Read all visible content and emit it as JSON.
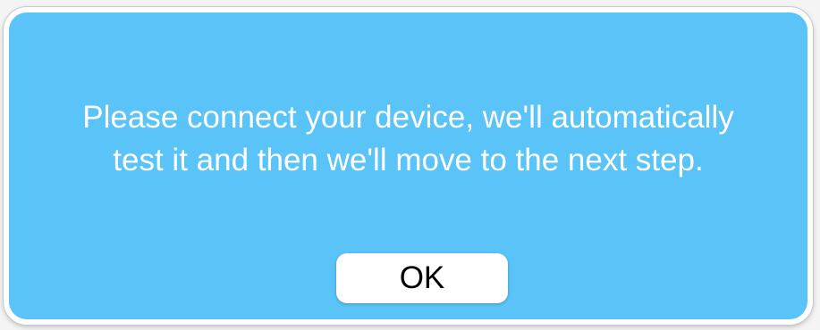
{
  "dialog": {
    "message_lines": [
      "Please connect your device, we'll automatically",
      "test it and then we'll move to the next step."
    ],
    "ok_label": "OK"
  },
  "colors": {
    "dialog_background": "#5ac3f7",
    "dialog_border": "#ffffff",
    "message_text": "#ffffff",
    "button_background": "#ffffff",
    "button_text": "#000000"
  }
}
